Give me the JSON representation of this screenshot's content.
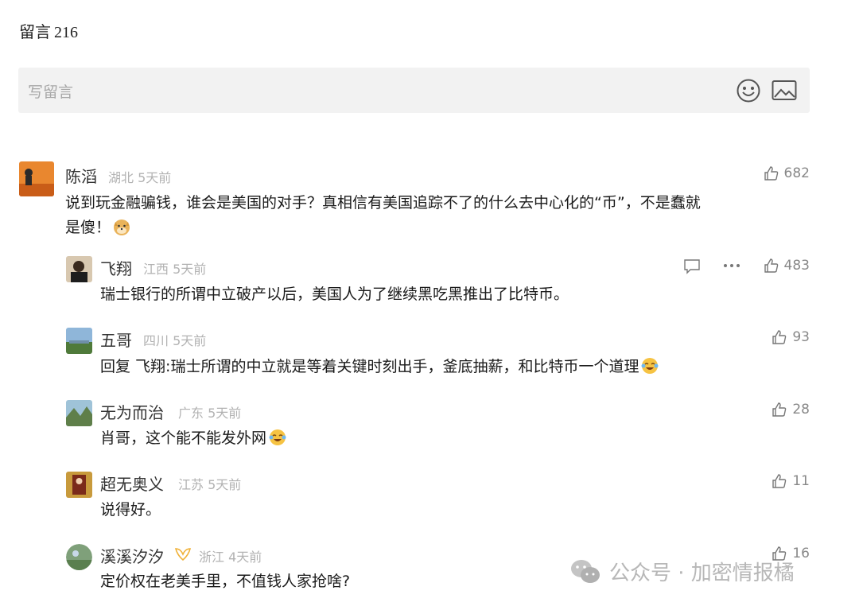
{
  "header": {
    "title": "留言",
    "count": "216"
  },
  "compose": {
    "placeholder": "写留言"
  },
  "comments": [
    {
      "name": "陈滔",
      "region": "湖北",
      "time": "5天前",
      "text": "说到玩金融骗钱，谁会是美国的对手？真相信有美国追踪不了的什么去中心化的“币”，不是蠢就",
      "text2": "是傻！",
      "likes": "682"
    },
    {
      "name": "飞翔",
      "region": "江西",
      "time": "5天前",
      "text": "瑞士银行的所谓中立破产以后，美国人为了继续黑吃黑推出了比特币。",
      "likes": "483"
    },
    {
      "name": "五哥",
      "region": "四川",
      "time": "5天前",
      "reply_prefix": "回复 飞翔:",
      "text": "瑞士所谓的中立就是等着关键时刻出手，釜底抽薪，和比特币一个道理",
      "likes": "93"
    },
    {
      "name": "无为而治",
      "region": "广东",
      "time": "5天前",
      "text": "肖哥，这个能不能发外网",
      "likes": "28"
    },
    {
      "name": "超无奥义",
      "region": "江苏",
      "time": "5天前",
      "text": "说得好。",
      "likes": "11"
    },
    {
      "name": "溪溪汐汐",
      "region": "浙江",
      "time": "4天前",
      "text": "定价权在老美手里，不值钱人家抢啥?",
      "likes": "16"
    }
  ],
  "watermark": "公众号 · 加密情报橘"
}
